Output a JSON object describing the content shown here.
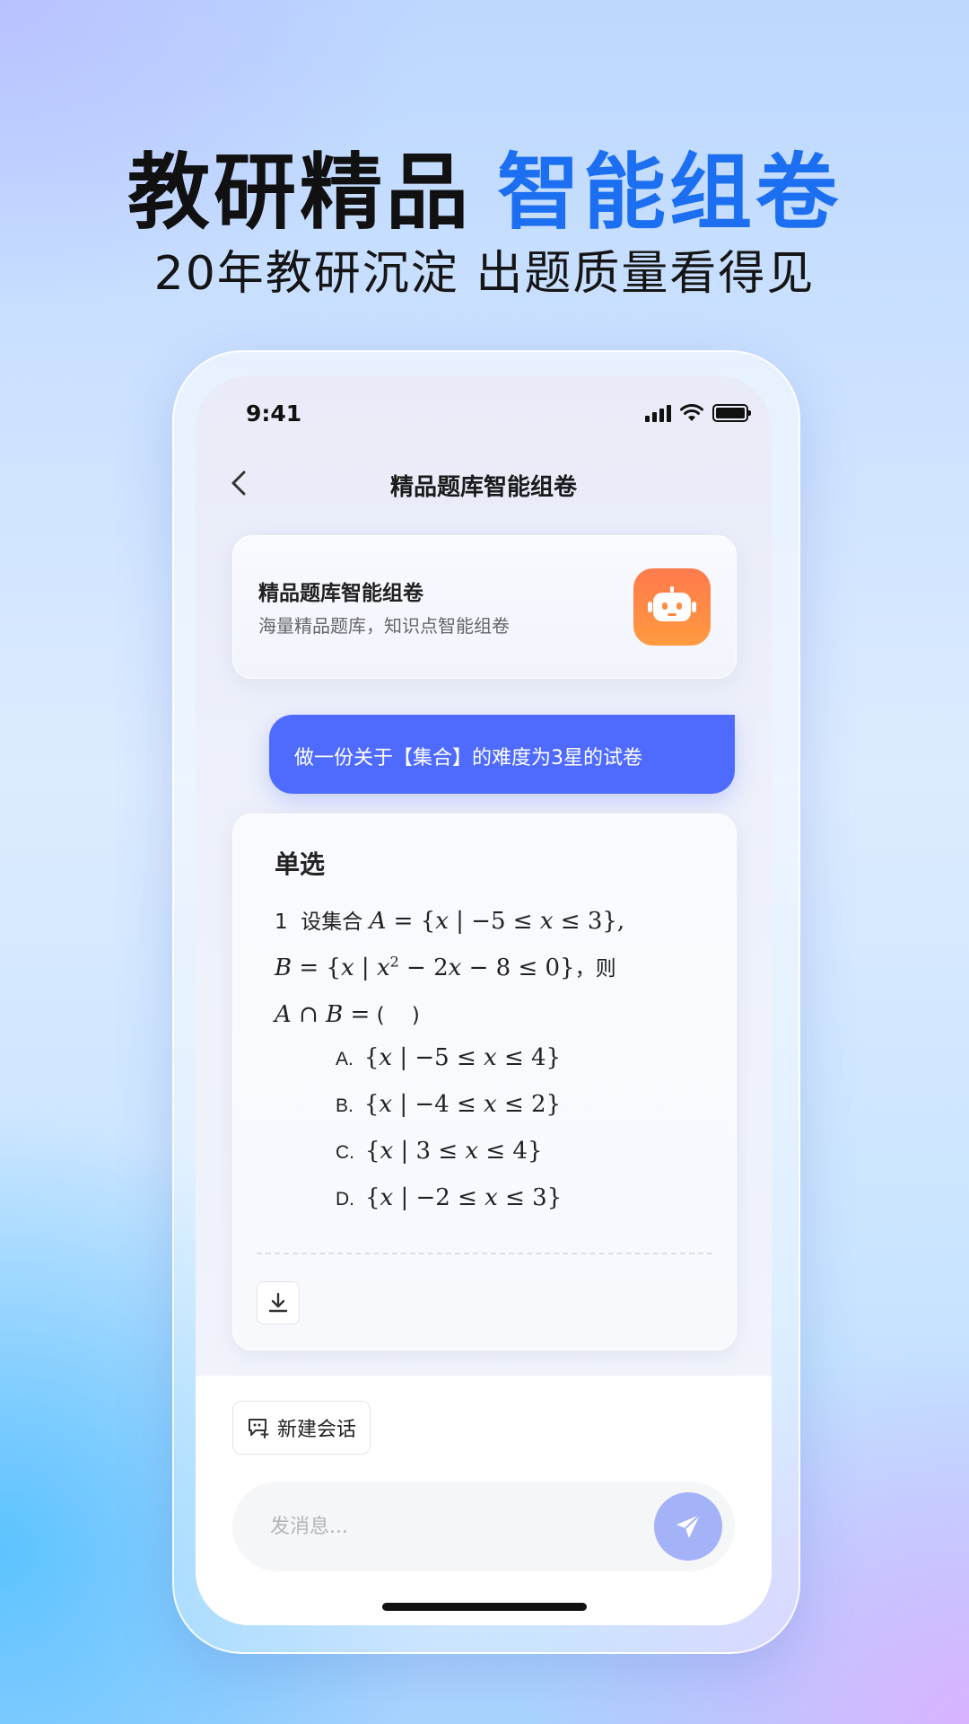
{
  "headline": {
    "main": "教研精品",
    "accent": "智能组卷"
  },
  "subline": "20年教研沉淀 出题质量看得见",
  "status_bar": {
    "time": "9:41"
  },
  "nav": {
    "title": "精品题库智能组卷"
  },
  "intro_card": {
    "title": "精品题库智能组卷",
    "subtitle": "海量精品题库，知识点智能组卷"
  },
  "user_message": "做一份关于【集合】的难度为3星的试卷",
  "answer": {
    "section": "单选",
    "q_num": "1",
    "q_prefix": "设集合",
    "q_then": "，则",
    "q_paren": "(　 )",
    "options": [
      {
        "letter": "A.",
        "lower": "−5",
        "upper": "4"
      },
      {
        "letter": "B.",
        "lower": "−4",
        "upper": "2"
      },
      {
        "letter": "C.",
        "lower": "3",
        "upper": "4"
      },
      {
        "letter": "D.",
        "lower": "−2",
        "upper": "3"
      }
    ]
  },
  "bottom": {
    "new_chat_label": "新建会话",
    "input_placeholder": "发消息..."
  },
  "colors": {
    "accent": "#1d6ff2",
    "bubble": "#4f6bff",
    "bot_icon": "#ff8a45",
    "send": "#a4b2f7"
  }
}
